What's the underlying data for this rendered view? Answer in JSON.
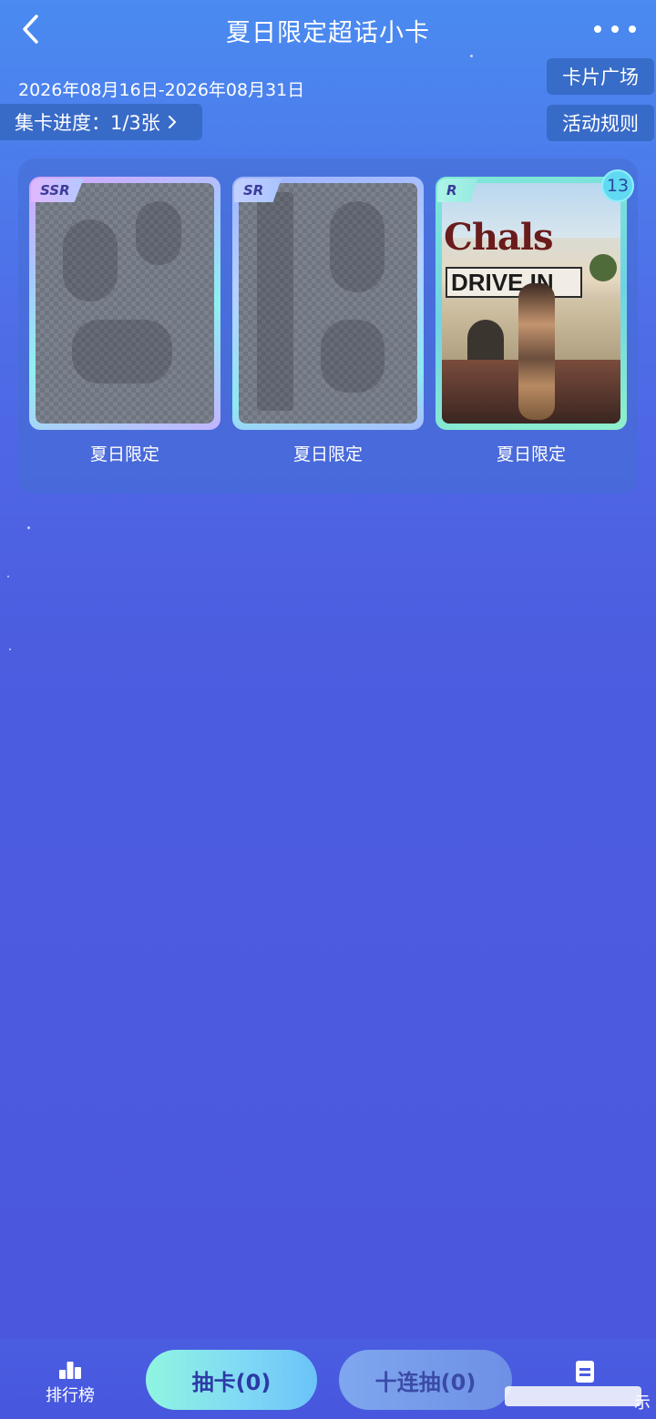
{
  "header": {
    "title": "夏日限定超话小卡",
    "back_icon": "chevron-left-icon",
    "more_icon": "more-dots-icon"
  },
  "event": {
    "date_range": "2026年08月16日-2026年08月31日",
    "progress_label": "集卡进度：1/3张",
    "card_square_label": "卡片广场",
    "rules_label": "活动规则"
  },
  "cards": [
    {
      "rarity": "SSR",
      "label": "夏日限定",
      "owned": false
    },
    {
      "rarity": "SR",
      "label": "夏日限定",
      "owned": false
    },
    {
      "rarity": "R",
      "label": "夏日限定",
      "owned": true,
      "count": "13",
      "photo_text_1": "Chals",
      "photo_text_2": "DRIVE IN"
    }
  ],
  "bottom_bar": {
    "rank_label": "排行榜",
    "rank_icon": "leaderboard-icon",
    "draw_label": "抽卡(0)",
    "draw10_label": "十连抽(0)",
    "record_icon": "document-icon",
    "record_partial_text": "示"
  },
  "colors": {
    "background_top": "#4a8bf0",
    "background_bottom": "#4b57de",
    "draw_button": "#8ff5e0",
    "draw10_button": "#7fa7ee"
  }
}
